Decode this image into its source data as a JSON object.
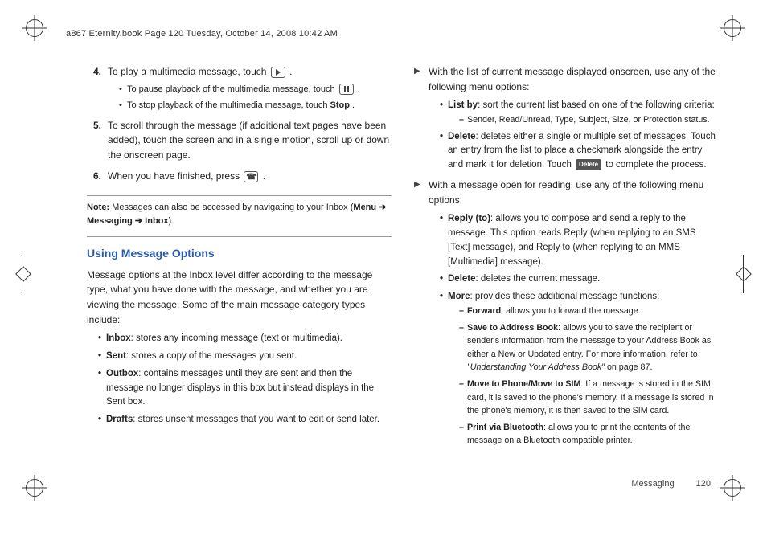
{
  "header": {
    "line": "a867 Eternity.book  Page 120  Tuesday, October 14, 2008  10:42 AM"
  },
  "left": {
    "step4": {
      "num": "4.",
      "text": "To play a multimedia message, touch ",
      "period": ".",
      "sub_pause_pre": "To pause playback of the multimedia message, touch ",
      "sub_pause_post": ".",
      "sub_stop_pre": "To stop playback of the multimedia message, touch ",
      "sub_stop_bold": "Stop",
      "sub_stop_post": "."
    },
    "step5": {
      "num": "5.",
      "text": "To scroll through the message (if additional text pages have been added), touch the screen and in a single motion, scroll up or down the onscreen page."
    },
    "step6": {
      "num": "6.",
      "text_pre": "When you have finished, press ",
      "text_post": "."
    },
    "note": {
      "label": "Note:",
      "text_pre": "Messages can also be accessed by navigating to your Inbox (",
      "trail_menu": "Menu ➔ Messaging ➔ Inbox",
      "text_post": ")."
    },
    "section_title": "Using Message Options",
    "intro": "Message options at the Inbox level differ according to the message type, what you have done with the message, and whether you are viewing the message. Some of the main message category types include:",
    "cats": {
      "inbox_b": "Inbox",
      "inbox_t": ": stores any incoming message (text or multimedia).",
      "sent_b": "Sent",
      "sent_t": ": stores a copy of the messages you sent.",
      "outbox_b": "Outbox",
      "outbox_t": ": contains messages until they are sent and then the message no longer displays in this box but instead displays in the Sent box.",
      "drafts_b": "Drafts",
      "drafts_t": ": stores unsent messages that you want to edit or send later."
    }
  },
  "right": {
    "listview_intro": "With the list of current message displayed onscreen, use any of the following menu options:",
    "listby_b": "List by",
    "listby_t": ": sort the current list based on one of the following criteria:",
    "listby_sub": "Sender, Read/Unread, Type, Subject, Size, or Protection status.",
    "delete_b": "Delete",
    "delete_t_pre": ": deletes either a single or multiple set of messages. Touch an entry from the list to place a checkmark alongside the entry and mark it for deletion. Touch ",
    "delete_t_post": " to complete the process.",
    "openview_intro": "With a message open for reading, use any of the following menu options:",
    "reply_b": "Reply (to)",
    "reply_t": ": allows you to compose and send a reply to the message. This option reads Reply (when replying to an SMS [Text] message), and Reply to (when replying to an MMS [Multimedia] message).",
    "delete2_b": "Delete",
    "delete2_t": ": deletes the current message.",
    "more_b": "More",
    "more_t": ": provides these additional message functions:",
    "forward_b": "Forward",
    "forward_t": ": allows you to forward the message.",
    "save_b": "Save to Address Book",
    "save_t_pre": ": allows you to save the recipient or sender's information from the message to your Address Book as either a New or Updated entry. For more information, refer to ",
    "save_ref": "\"Understanding Your Address Book\"",
    "save_t_post": "  on page 87.",
    "move_b": "Move to Phone/Move to SIM",
    "move_t": ": If a message is stored in the SIM card, it is saved to the phone's memory. If a message is stored in the phone's memory, it is then saved to the SIM card.",
    "print_b": "Print via Bluetooth",
    "print_t": ": allows you to print the contents of the message on a Bluetooth compatible printer."
  },
  "footer": {
    "section": "Messaging",
    "page": "120"
  },
  "icons": {
    "delete_label": "Delete"
  }
}
